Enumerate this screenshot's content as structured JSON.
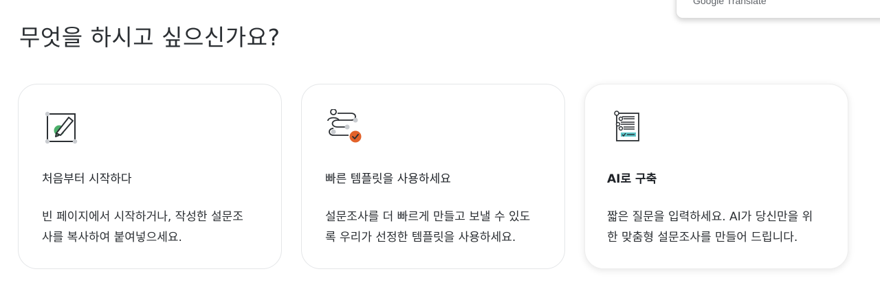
{
  "translate_popup": {
    "label": "Google Translate"
  },
  "page_title": "무엇을 하시고 싶으신가요?",
  "cards": [
    {
      "icon": "edit-canvas-icon",
      "title": "처음부터 시작하다",
      "description_lines": [
        "빈 페이지에서 시작하거나, 작성한 설문조",
        "사를 복사하여 붙여넣으세요."
      ]
    },
    {
      "icon": "template-flow-icon",
      "title": "빠른 템플릿을 사용하세요",
      "description_lines": [
        "설문조사를 더 빠르게 만들고 보낼 수 있도",
        "록 우리가 선정한 템플릿을 사용하세요."
      ]
    },
    {
      "icon": "ai-checklist-icon",
      "title": "AI로 구축",
      "description_lines": [
        "짧은 질문을 입력하세요. AI가 당신만을 위",
        "한 맞춤형 설문조사를 만들어 드립니다."
      ]
    }
  ],
  "colors": {
    "accent_green": "#4caf6a",
    "accent_orange": "#e2622a",
    "accent_teal": "#5cc6c9"
  }
}
